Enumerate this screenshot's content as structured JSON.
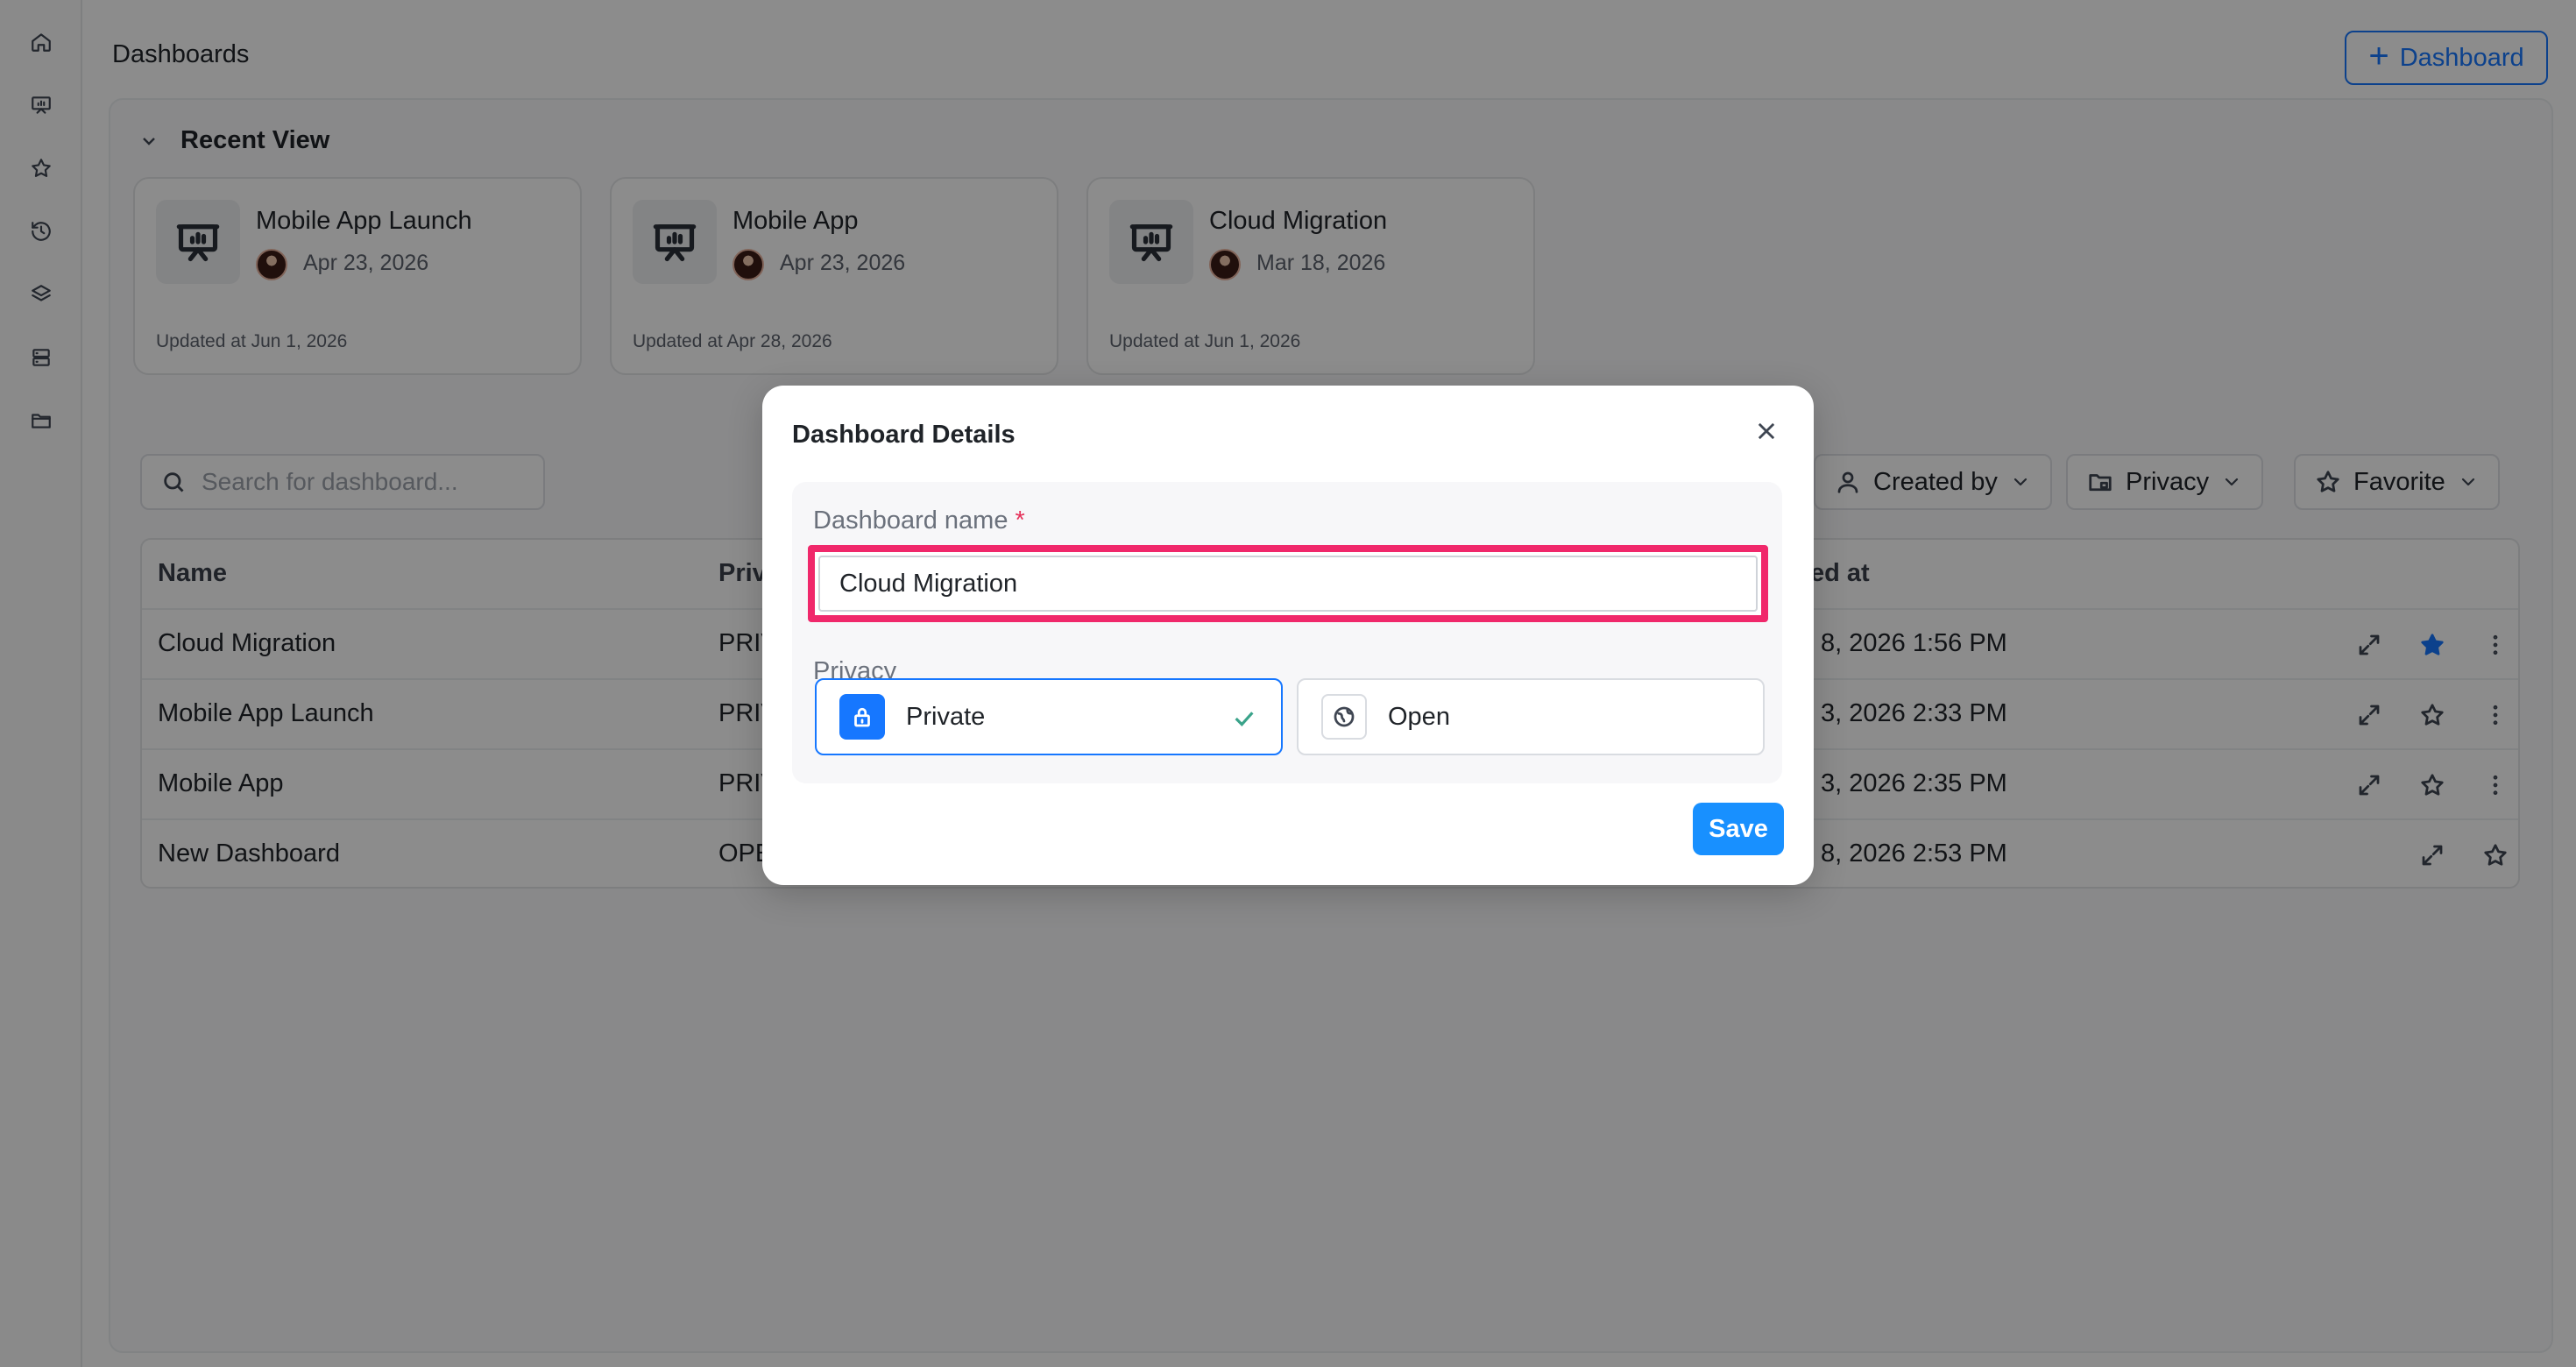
{
  "header": {
    "title": "Dashboards",
    "add_button_label": "Dashboard"
  },
  "recent": {
    "title": "Recent View",
    "cards": [
      {
        "title": "Mobile App Launch",
        "date": "Apr 23, 2026",
        "updated": "Updated at Jun 1, 2026"
      },
      {
        "title": "Mobile App",
        "date": "Apr 23, 2026",
        "updated": "Updated at Apr 28, 2026"
      },
      {
        "title": "Cloud Migration",
        "date": "Mar 18, 2026",
        "updated": "Updated at Jun 1, 2026"
      }
    ]
  },
  "toolbar": {
    "search_placeholder": "Search for dashboard...",
    "filters": {
      "created_by": "Created by",
      "privacy": "Privacy",
      "favorite": "Favorite"
    }
  },
  "table": {
    "columns": {
      "name": "Name",
      "privacy": "Priv",
      "updated": "ed at"
    },
    "rows": [
      {
        "name": "Cloud Migration",
        "privacy": "PRIV",
        "updated": "8, 2026 1:56 PM",
        "favorite": true
      },
      {
        "name": "Mobile App Launch",
        "privacy": "PRIV",
        "updated": "3, 2026 2:33 PM",
        "favorite": false
      },
      {
        "name": "Mobile App",
        "privacy": "PRIV",
        "updated": "3, 2026 2:35 PM",
        "favorite": false
      },
      {
        "name": "New Dashboard",
        "privacy": "OPE",
        "updated": "8, 2026 2:53 PM",
        "favorite": false
      }
    ]
  },
  "modal": {
    "title": "Dashboard Details",
    "name_label": "Dashboard name",
    "required_mark": "*",
    "name_value": "Cloud Migration",
    "privacy_label": "Privacy",
    "options": {
      "private": "Private",
      "open": "Open"
    },
    "selected_option": "Private",
    "save_label": "Save"
  },
  "colors": {
    "accent": "#1677ff",
    "highlight": "#f0286b",
    "favorite": "#1677ff"
  },
  "icons": [
    "home-icon",
    "presentation-icon",
    "star-icon",
    "history-icon",
    "layers-icon",
    "database-icon",
    "folder-icon",
    "search-icon",
    "user-icon",
    "folder-lock-icon",
    "chevron-down-icon",
    "expand-icon",
    "more-vertical-icon",
    "lock-icon",
    "globe-icon",
    "check-icon",
    "close-icon"
  ]
}
